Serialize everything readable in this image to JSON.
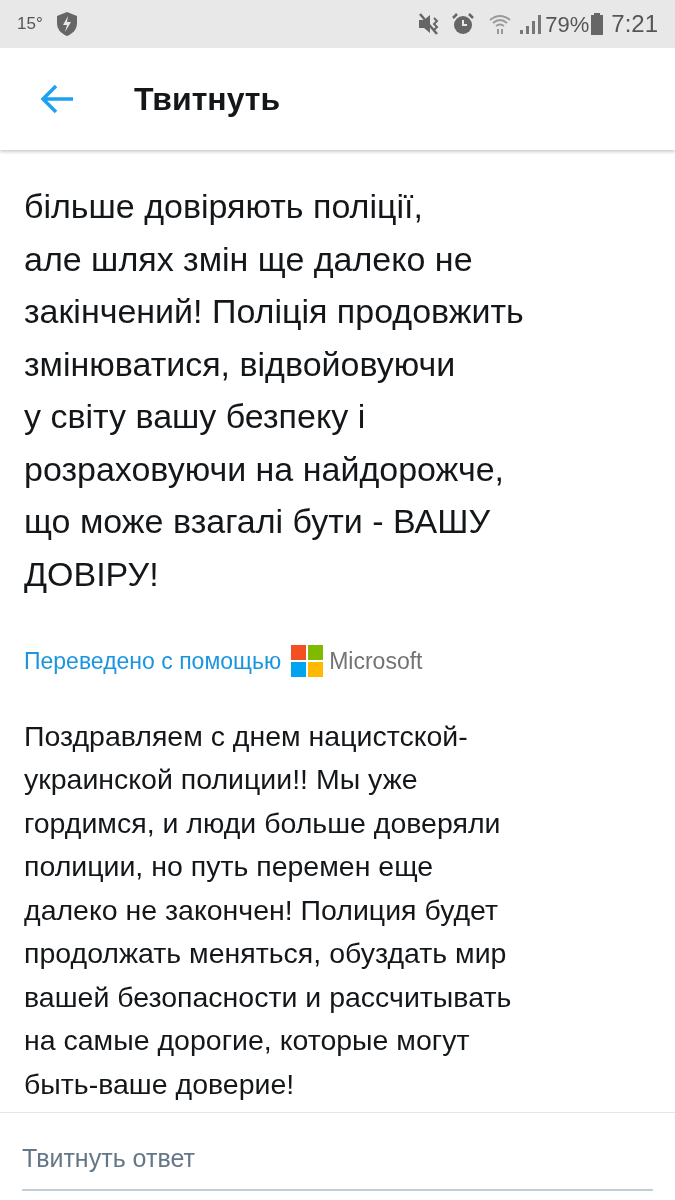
{
  "status_bar": {
    "temperature": "15°",
    "battery": "79%",
    "time": "7:21"
  },
  "header": {
    "title": "Твитнуть"
  },
  "tweet": {
    "original_text": "більше довіряють поліції,\nале шлях змін ще далеко не\nзакінчений! Поліція продовжить\nзмінюватися, відвойовуючи\nу світу вашу безпеку і\nрозраховуючи на найдорожче,\nщо може взагалі бути - ВАШУ\nДОВІРУ!",
    "translated_by": "Переведено с помощью",
    "translator": "Microsoft",
    "translation": "Поздравляем с днем нацистской-\nукраинской полиции!!  Мы уже\nгордимся, и люди больше доверяли\nполиции, но путь перемен еще\nдалеко не закончен! Полиция будет\nпродолжать меняться, обуздать мир\nвашей безопасности и рассчитывать\nна самые дорогие, которые могут\nбыть-ваше доверие!"
  },
  "reply": {
    "placeholder": "Твитнуть ответ"
  }
}
